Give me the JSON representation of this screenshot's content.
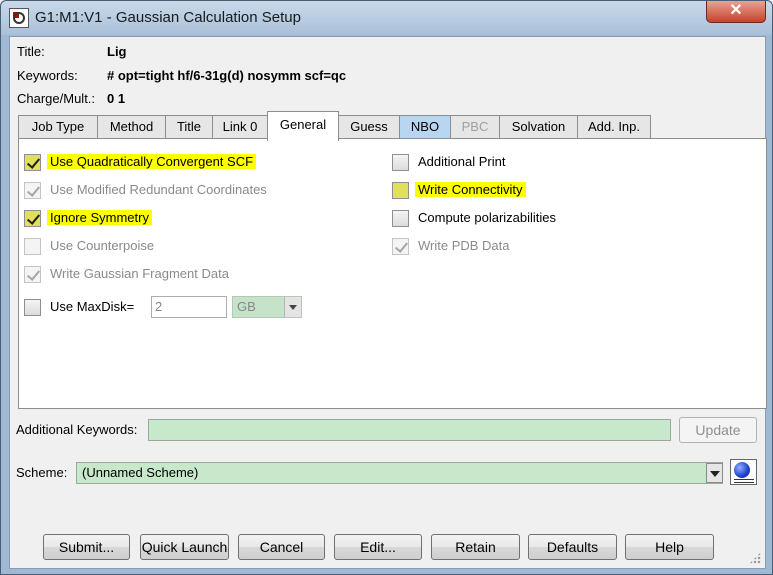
{
  "window": {
    "title": "G1:M1:V1 - Gaussian Calculation Setup",
    "close_label": "✕"
  },
  "header": {
    "title_label": "Title:",
    "title_value": "Lig",
    "keywords_label": "Keywords:",
    "keywords_value": "# opt=tight hf/6-31g(d) nosymm scf=qc",
    "charge_label": "Charge/Mult.:",
    "charge_value": "0 1"
  },
  "tabs": [
    {
      "label": "Job Type"
    },
    {
      "label": "Method"
    },
    {
      "label": "Title"
    },
    {
      "label": "Link 0"
    },
    {
      "label": "General"
    },
    {
      "label": "Guess"
    },
    {
      "label": "NBO"
    },
    {
      "label": "PBC"
    },
    {
      "label": "Solvation"
    },
    {
      "label": "Add. Inp."
    }
  ],
  "active_tab": "General",
  "options_left": [
    {
      "label": "Use Quadratically Convergent SCF",
      "checked": true,
      "enabled": true,
      "highlighted": true
    },
    {
      "label": "Use Modified Redundant Coordinates",
      "checked": true,
      "enabled": false,
      "highlighted": false
    },
    {
      "label": "Ignore Symmetry",
      "checked": true,
      "enabled": true,
      "highlighted": true
    },
    {
      "label": "Use Counterpoise",
      "checked": false,
      "enabled": false,
      "highlighted": false
    },
    {
      "label": "Write Gaussian Fragment Data",
      "checked": true,
      "enabled": false,
      "highlighted": false
    },
    {
      "label": "Use MaxDisk=",
      "checked": false,
      "enabled": true,
      "highlighted": false
    }
  ],
  "options_right": [
    {
      "label": "Additional Print",
      "checked": false,
      "enabled": true,
      "highlighted": false
    },
    {
      "label": "Write Connectivity",
      "checked": false,
      "enabled": true,
      "highlighted": true
    },
    {
      "label": "Compute polarizabilities",
      "checked": false,
      "enabled": true,
      "highlighted": false
    },
    {
      "label": "Write PDB Data",
      "checked": true,
      "enabled": false,
      "highlighted": false
    }
  ],
  "maxdisk": {
    "value": "2",
    "unit": "GB"
  },
  "additional_keywords": {
    "label": "Additional Keywords:",
    "value": "",
    "update_label": "Update"
  },
  "scheme": {
    "label": "Scheme:",
    "value": "(Unnamed Scheme)"
  },
  "buttons": {
    "submit": "Submit...",
    "quick_launch": "Quick Launch",
    "cancel": "Cancel",
    "edit": "Edit...",
    "retain": "Retain",
    "defaults": "Defaults",
    "help": "Help"
  },
  "colors": {
    "highlight": "#ffff00",
    "field_green": "#c8e8cc",
    "nbo_tab": "#b9d6f0"
  }
}
